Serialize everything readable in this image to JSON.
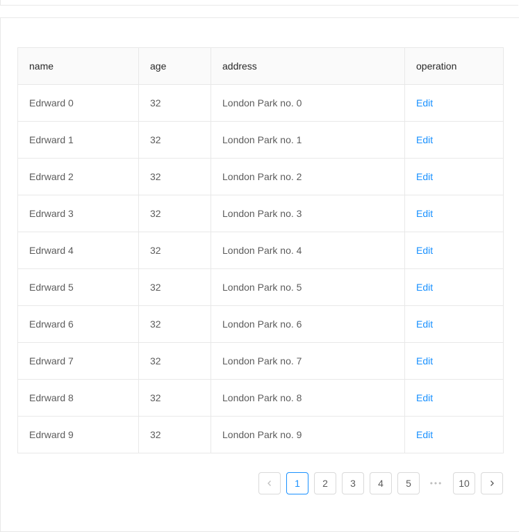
{
  "table": {
    "columns": [
      "name",
      "age",
      "address",
      "operation"
    ],
    "rows": [
      {
        "name": "Edrward 0",
        "age": "32",
        "address": "London Park no. 0",
        "action": "Edit"
      },
      {
        "name": "Edrward 1",
        "age": "32",
        "address": "London Park no. 1",
        "action": "Edit"
      },
      {
        "name": "Edrward 2",
        "age": "32",
        "address": "London Park no. 2",
        "action": "Edit"
      },
      {
        "name": "Edrward 3",
        "age": "32",
        "address": "London Park no. 3",
        "action": "Edit"
      },
      {
        "name": "Edrward 4",
        "age": "32",
        "address": "London Park no. 4",
        "action": "Edit"
      },
      {
        "name": "Edrward 5",
        "age": "32",
        "address": "London Park no. 5",
        "action": "Edit"
      },
      {
        "name": "Edrward 6",
        "age": "32",
        "address": "London Park no. 6",
        "action": "Edit"
      },
      {
        "name": "Edrward 7",
        "age": "32",
        "address": "London Park no. 7",
        "action": "Edit"
      },
      {
        "name": "Edrward 8",
        "age": "32",
        "address": "London Park no. 8",
        "action": "Edit"
      },
      {
        "name": "Edrward 9",
        "age": "32",
        "address": "London Park no. 9",
        "action": "Edit"
      }
    ]
  },
  "pagination": {
    "prev_icon": "chevron-left-icon",
    "next_icon": "chevron-right-icon",
    "pages": [
      "1",
      "2",
      "3",
      "4",
      "5"
    ],
    "ellipsis": "•••",
    "last_page": "10",
    "current": "1"
  },
  "colors": {
    "accent": "#1890ff",
    "border": "#e8e8e8",
    "header_bg": "#fafafa"
  }
}
